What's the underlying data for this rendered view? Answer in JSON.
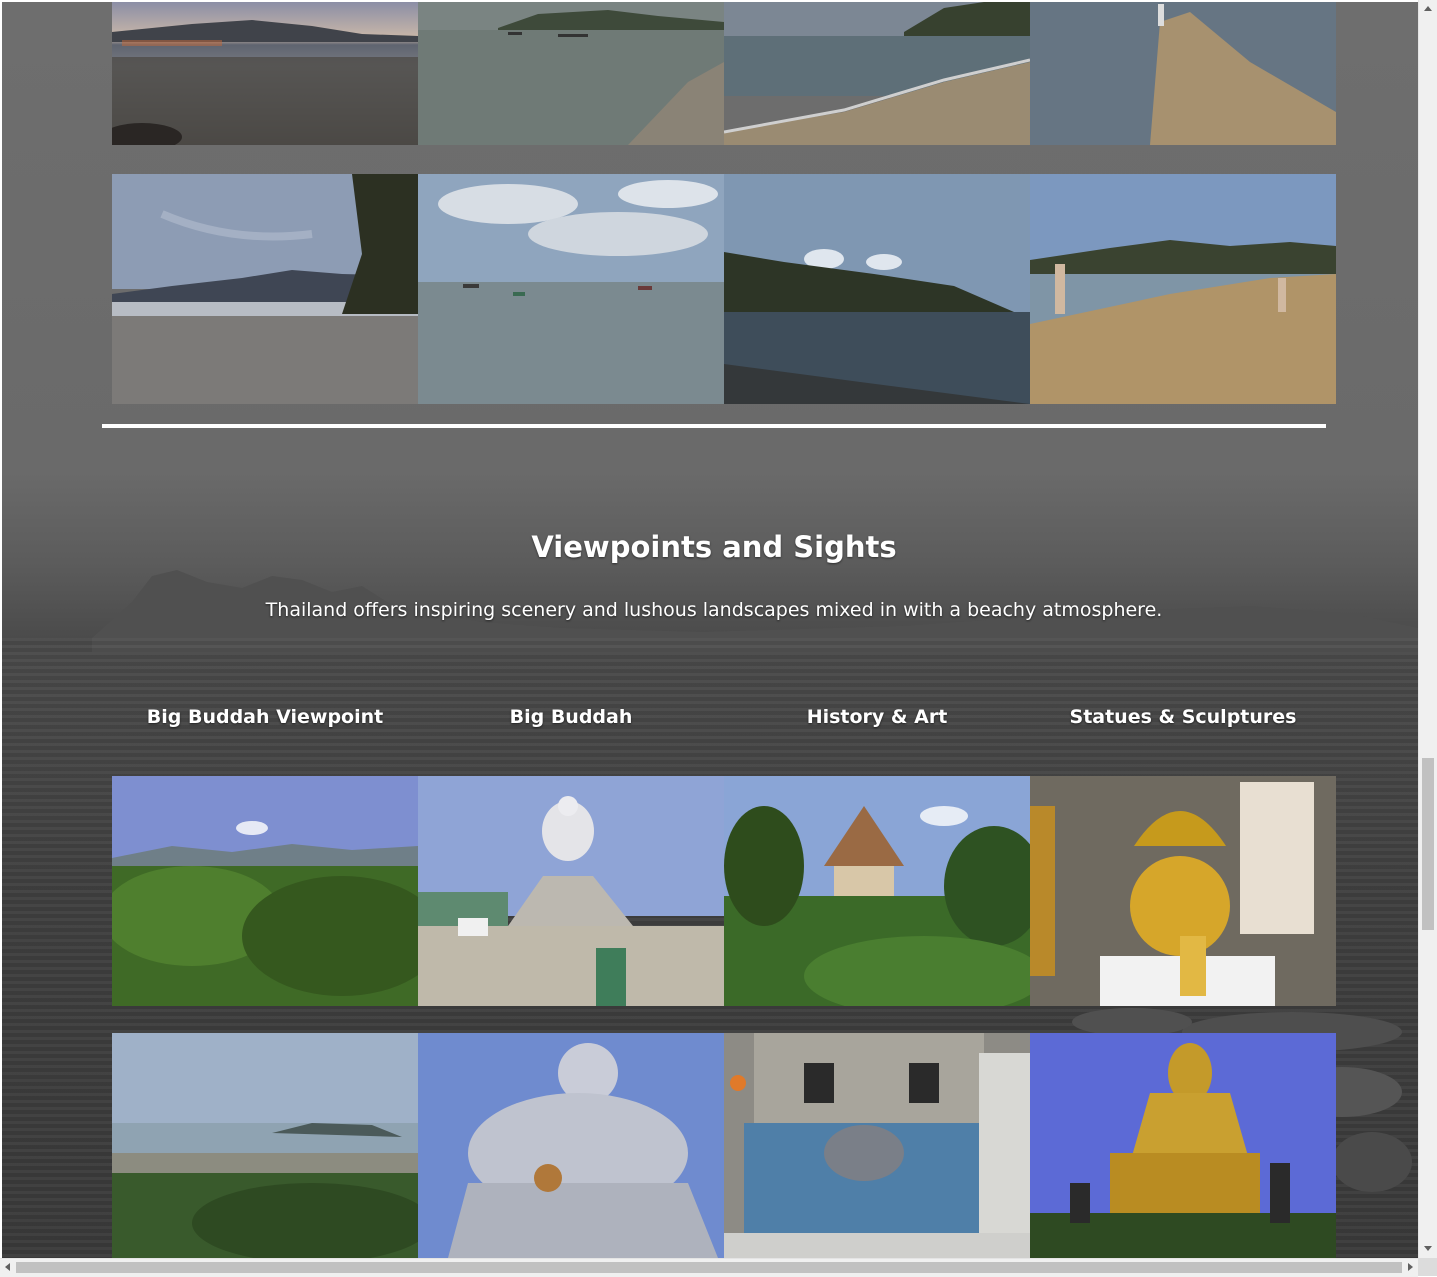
{
  "section": {
    "title": "Viewpoints and Sights",
    "subtitle": "Thailand offers inspiring scenery and lushous landscapes mixed in with a beachy atmosphere."
  },
  "columns": [
    {
      "heading": "Big Buddah Viewpoint"
    },
    {
      "heading": "Big Buddah"
    },
    {
      "heading": "History & Art"
    },
    {
      "heading": "Statues & Sculptures"
    }
  ],
  "beach_photos": [
    {
      "icon": "beach-sunset-photo"
    },
    {
      "icon": "shallow-sea-photo"
    },
    {
      "icon": "shoreline-photo"
    },
    {
      "icon": "sandbar-footprints-photo"
    },
    {
      "icon": "beach-dusk-photo"
    },
    {
      "icon": "cloudy-sea-boats-photo"
    },
    {
      "icon": "headland-water-photo"
    },
    {
      "icon": "sandbar-walkers-photo"
    }
  ],
  "sight_photos": [
    {
      "icon": "jungle-viewpoint-photo"
    },
    {
      "icon": "big-buddha-stairs-photo"
    },
    {
      "icon": "temple-garden-photo"
    },
    {
      "icon": "golden-naga-buddha-photo"
    },
    {
      "icon": "bay-panorama-photo"
    },
    {
      "icon": "big-buddha-closeup-photo"
    },
    {
      "icon": "sea-mural-wall-photo"
    },
    {
      "icon": "golden-buddha-statue-photo"
    }
  ],
  "colors": {
    "background": "#5a5a5a",
    "text": "#ffffff",
    "divider": "#ffffff",
    "scrollbar_thumb": "#c1c1c1"
  }
}
